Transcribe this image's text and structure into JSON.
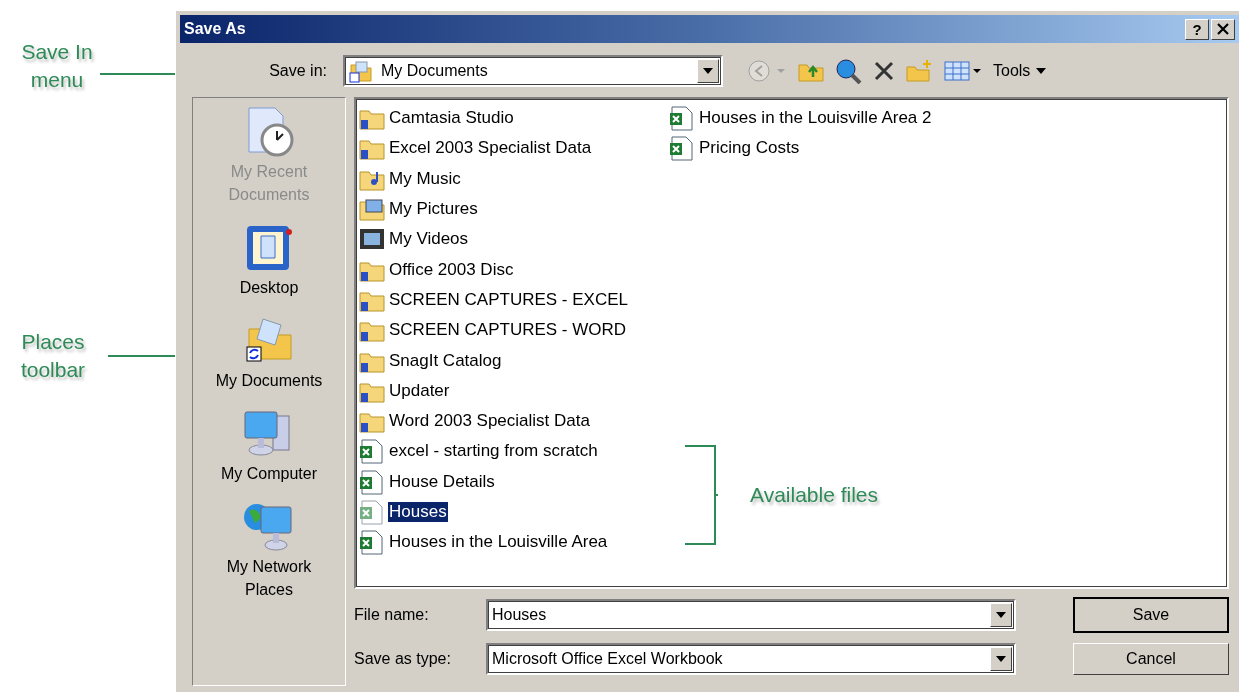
{
  "window": {
    "title": "Save As",
    "help": "?"
  },
  "save_in": {
    "label": "Save in:",
    "value": "My Documents"
  },
  "toolbar": {
    "tools": "Tools"
  },
  "places": [
    {
      "label": "My Recent Documents",
      "kind": "recent",
      "disabled": true
    },
    {
      "label": "Desktop",
      "kind": "desktop",
      "disabled": false
    },
    {
      "label": "My Documents",
      "kind": "documents",
      "disabled": false
    },
    {
      "label": "My Computer",
      "kind": "computer",
      "disabled": false
    },
    {
      "label": "My Network Places",
      "kind": "network",
      "disabled": false
    }
  ],
  "files": [
    {
      "name": "Camtasia Studio",
      "kind": "folder",
      "selected": false
    },
    {
      "name": "Excel 2003 Specialist Data",
      "kind": "folder",
      "selected": false
    },
    {
      "name": "My Music",
      "kind": "music",
      "selected": false
    },
    {
      "name": "My Pictures",
      "kind": "pictures",
      "selected": false
    },
    {
      "name": "My Videos",
      "kind": "videos",
      "selected": false
    },
    {
      "name": "Office 2003 Disc",
      "kind": "folder",
      "selected": false
    },
    {
      "name": "SCREEN CAPTURES - EXCEL",
      "kind": "folder",
      "selected": false
    },
    {
      "name": "SCREEN CAPTURES - WORD",
      "kind": "folder",
      "selected": false
    },
    {
      "name": "SnagIt Catalog",
      "kind": "folder",
      "selected": false
    },
    {
      "name": "Updater",
      "kind": "folder",
      "selected": false
    },
    {
      "name": "Word 2003 Specialist Data",
      "kind": "folder",
      "selected": false
    },
    {
      "name": "excel - starting from scratch",
      "kind": "workbook",
      "selected": false
    },
    {
      "name": "House Details",
      "kind": "workbook",
      "selected": false
    },
    {
      "name": "Houses",
      "kind": "workbook",
      "selected": true
    },
    {
      "name": "Houses in the Louisville Area",
      "kind": "workbook",
      "selected": false
    },
    {
      "name": "Houses in the Louisville Area 2",
      "kind": "workbook",
      "selected": false
    },
    {
      "name": "Pricing Costs",
      "kind": "workbook",
      "selected": false
    }
  ],
  "file_name": {
    "label": "File name:",
    "value": "Houses"
  },
  "save_type": {
    "label": "Save as type:",
    "value": "Microsoft Office Excel Workbook"
  },
  "buttons": [
    {
      "label": "Save",
      "default": true
    },
    {
      "label": "Cancel",
      "default": false
    }
  ],
  "annotations": {
    "save_in": "Save In menu",
    "places": "Places toolbar",
    "files": "Available files"
  }
}
